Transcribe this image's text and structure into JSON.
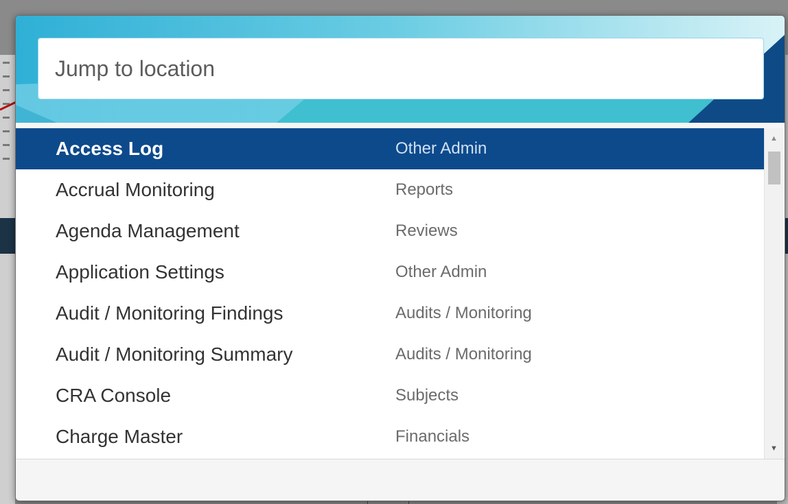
{
  "search": {
    "placeholder": "Jump to location",
    "value": ""
  },
  "results": [
    {
      "name": "Access Log",
      "category": "Other Admin",
      "selected": true
    },
    {
      "name": "Accrual Monitoring",
      "category": "Reports",
      "selected": false
    },
    {
      "name": "Agenda Management",
      "category": "Reviews",
      "selected": false
    },
    {
      "name": "Application Settings",
      "category": "Other Admin",
      "selected": false
    },
    {
      "name": "Audit / Monitoring Findings",
      "category": "Audits / Monitoring",
      "selected": false
    },
    {
      "name": "Audit / Monitoring Summary",
      "category": "Audits / Monitoring",
      "selected": false
    },
    {
      "name": "CRA Console",
      "category": "Subjects",
      "selected": false
    },
    {
      "name": "Charge Master",
      "category": "Financials",
      "selected": false
    }
  ],
  "colors": {
    "selected_row": "#0d4a8c",
    "header_gradient_start": "#3bb5d8",
    "header_gradient_end": "#c8eef5",
    "header_dark": "#0e4a86",
    "annotation_arrow": "#b01010"
  },
  "icons": {
    "scroll_up": "chevron-up-icon",
    "scroll_down": "chevron-down-icon"
  }
}
